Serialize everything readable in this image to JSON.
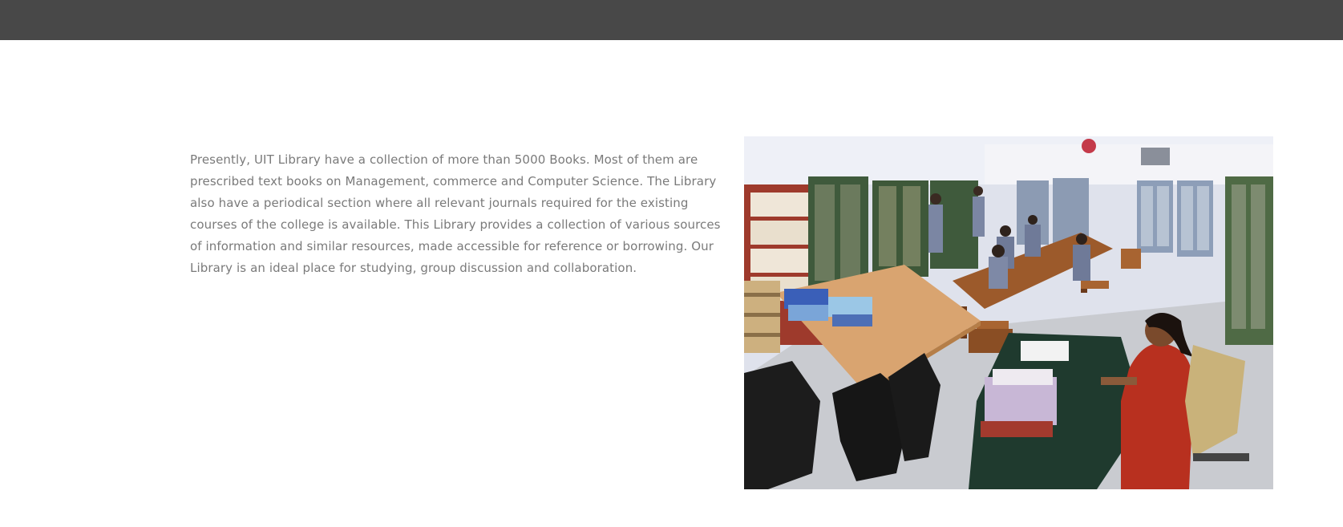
{
  "header": {
    "bar_color": "#484848"
  },
  "main": {
    "description": "Presently, UIT Library have a collection of more than 5000 Books. Most of them are prescribed text books on Management, commerce and Computer Science. The Library also have a periodical section where all relevant journals required for the existing courses of the college is available. This Library provides a collection of various sources of information and similar resources, made accessible for reference or borrowing. Our Library is an ideal place for studying, group discussion and collaboration.",
    "image": {
      "icon": "library-photo"
    }
  },
  "colors": {
    "text": "#7a7a7a",
    "background": "#ffffff"
  }
}
